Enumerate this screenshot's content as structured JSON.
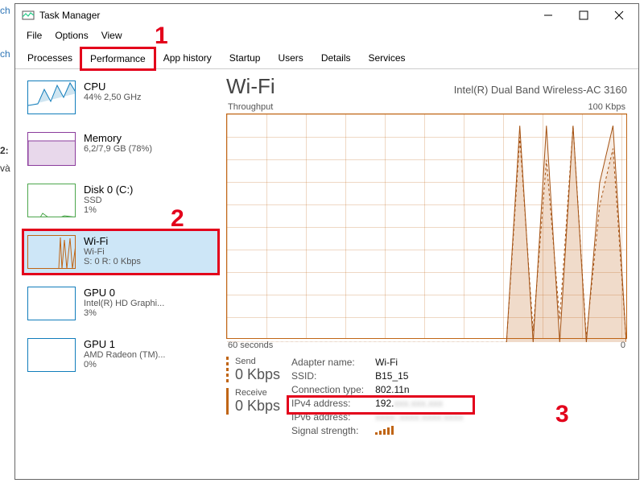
{
  "leftedge": {
    "l1": "ch",
    "l2": "ch",
    "l3": "2:",
    "l4": "và"
  },
  "annotations": {
    "n1": "1",
    "n2": "2",
    "n3": "3"
  },
  "titlebar": {
    "title": "Task Manager"
  },
  "menubar": {
    "file": "File",
    "options": "Options",
    "view": "View"
  },
  "tabs": {
    "processes": "Processes",
    "performance": "Performance",
    "apphistory": "App history",
    "startup": "Startup",
    "users": "Users",
    "details": "Details",
    "services": "Services"
  },
  "sidebar": {
    "items": [
      {
        "name": "CPU",
        "sub1": "44% 2,50 GHz",
        "sub2": ""
      },
      {
        "name": "Memory",
        "sub1": "6,2/7,9 GB (78%)",
        "sub2": ""
      },
      {
        "name": "Disk 0 (C:)",
        "sub1": "SSD",
        "sub2": "1%"
      },
      {
        "name": "Wi-Fi",
        "sub1": "Wi-Fi",
        "sub2": "S: 0 R: 0 Kbps"
      },
      {
        "name": "GPU 0",
        "sub1": "Intel(R) HD Graphi...",
        "sub2": "3%"
      },
      {
        "name": "GPU 1",
        "sub1": "AMD Radeon (TM)...",
        "sub2": "0%"
      }
    ]
  },
  "main": {
    "title": "Wi-Fi",
    "adapter": "Intel(R) Dual Band Wireless-AC 3160",
    "throughput_label": "Throughput",
    "throughput_scale": "100 Kbps",
    "time_left": "60 seconds",
    "time_right": "0",
    "send": {
      "label": "Send",
      "value": "0 Kbps"
    },
    "receive": {
      "label": "Receive",
      "value": "0 Kbps"
    },
    "details": {
      "adapter_name_k": "Adapter name:",
      "adapter_name_v": "Wi-Fi",
      "ssid_k": "SSID:",
      "ssid_v": "B15_15",
      "conn_k": "Connection type:",
      "conn_v": "802.11n",
      "ipv4_k": "IPv4 address:",
      "ipv4_v": "192.",
      "ipv6_k": "IPv6 address:",
      "signal_k": "Signal strength:"
    }
  },
  "chart_data": {
    "type": "line",
    "title": "Wi-Fi Throughput",
    "xlabel": "seconds",
    "ylabel": "Kbps",
    "xlim": [
      0,
      60
    ],
    "ylim": [
      0,
      100
    ],
    "x": [
      0,
      2,
      4,
      6,
      8,
      10,
      12,
      14,
      16,
      18,
      20,
      22,
      24,
      26,
      28,
      30,
      32,
      34,
      36,
      38,
      40,
      42,
      44,
      46,
      48,
      50,
      52,
      54,
      56,
      58,
      60
    ],
    "series": [
      {
        "name": "Send",
        "values": [
          0,
          0,
          0,
          0,
          0,
          0,
          0,
          0,
          0,
          0,
          0,
          0,
          0,
          0,
          0,
          0,
          0,
          0,
          0,
          0,
          0,
          0,
          90,
          5,
          80,
          10,
          95,
          2,
          60,
          85,
          0
        ]
      },
      {
        "name": "Receive",
        "values": [
          0,
          0,
          0,
          0,
          0,
          0,
          0,
          0,
          0,
          0,
          0,
          0,
          0,
          0,
          0,
          0,
          0,
          0,
          0,
          0,
          0,
          0,
          95,
          0,
          95,
          0,
          95,
          0,
          70,
          95,
          0
        ]
      }
    ]
  }
}
